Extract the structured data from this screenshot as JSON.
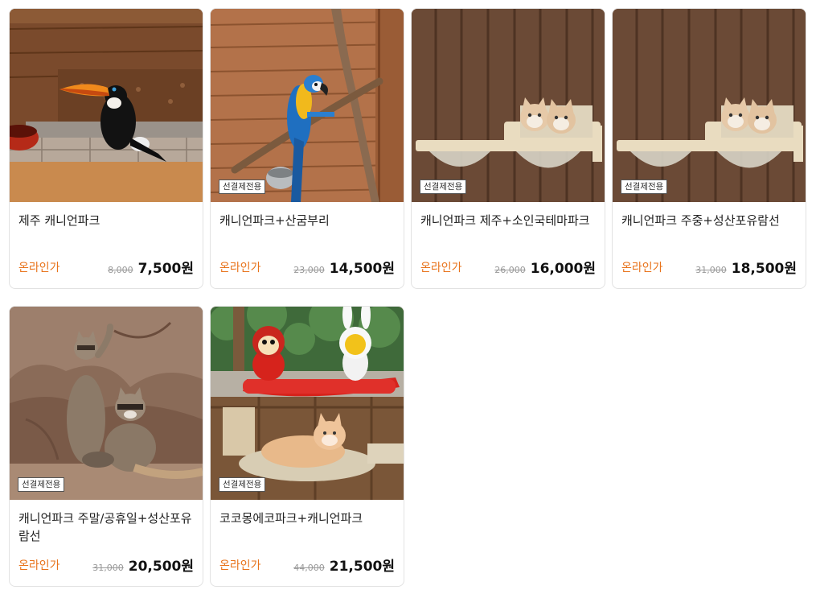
{
  "products": [
    {
      "title": "제주 캐니언파크",
      "badge": "",
      "online_label": "온라인가",
      "original_price": "8,000",
      "sale_price": "7,500원",
      "image": "toucan"
    },
    {
      "title": "캐니언파크+산굼부리",
      "badge": "선결제전용",
      "online_label": "온라인가",
      "original_price": "23,000",
      "sale_price": "14,500원",
      "image": "macaw"
    },
    {
      "title": "캐니언파크 제주+소인국테마파크",
      "badge": "선결제전용",
      "online_label": "온라인가",
      "original_price": "26,000",
      "sale_price": "16,000원",
      "image": "cats"
    },
    {
      "title": "캐니언파크 주중+성산포유람선",
      "badge": "선결제전용",
      "online_label": "온라인가",
      "original_price": "31,000",
      "sale_price": "18,500원",
      "image": "cats"
    },
    {
      "title": "캐니언파크 주말/공휴일+성산포유람선",
      "badge": "선결제전용",
      "online_label": "온라인가",
      "original_price": "31,000",
      "sale_price": "20,500원",
      "image": "raccoons"
    },
    {
      "title": "코코몽에코파크+캐니언파크",
      "badge": "선결제전용",
      "online_label": "온라인가",
      "original_price": "44,000",
      "sale_price": "21,500원",
      "image": "cocomong-cat"
    }
  ]
}
